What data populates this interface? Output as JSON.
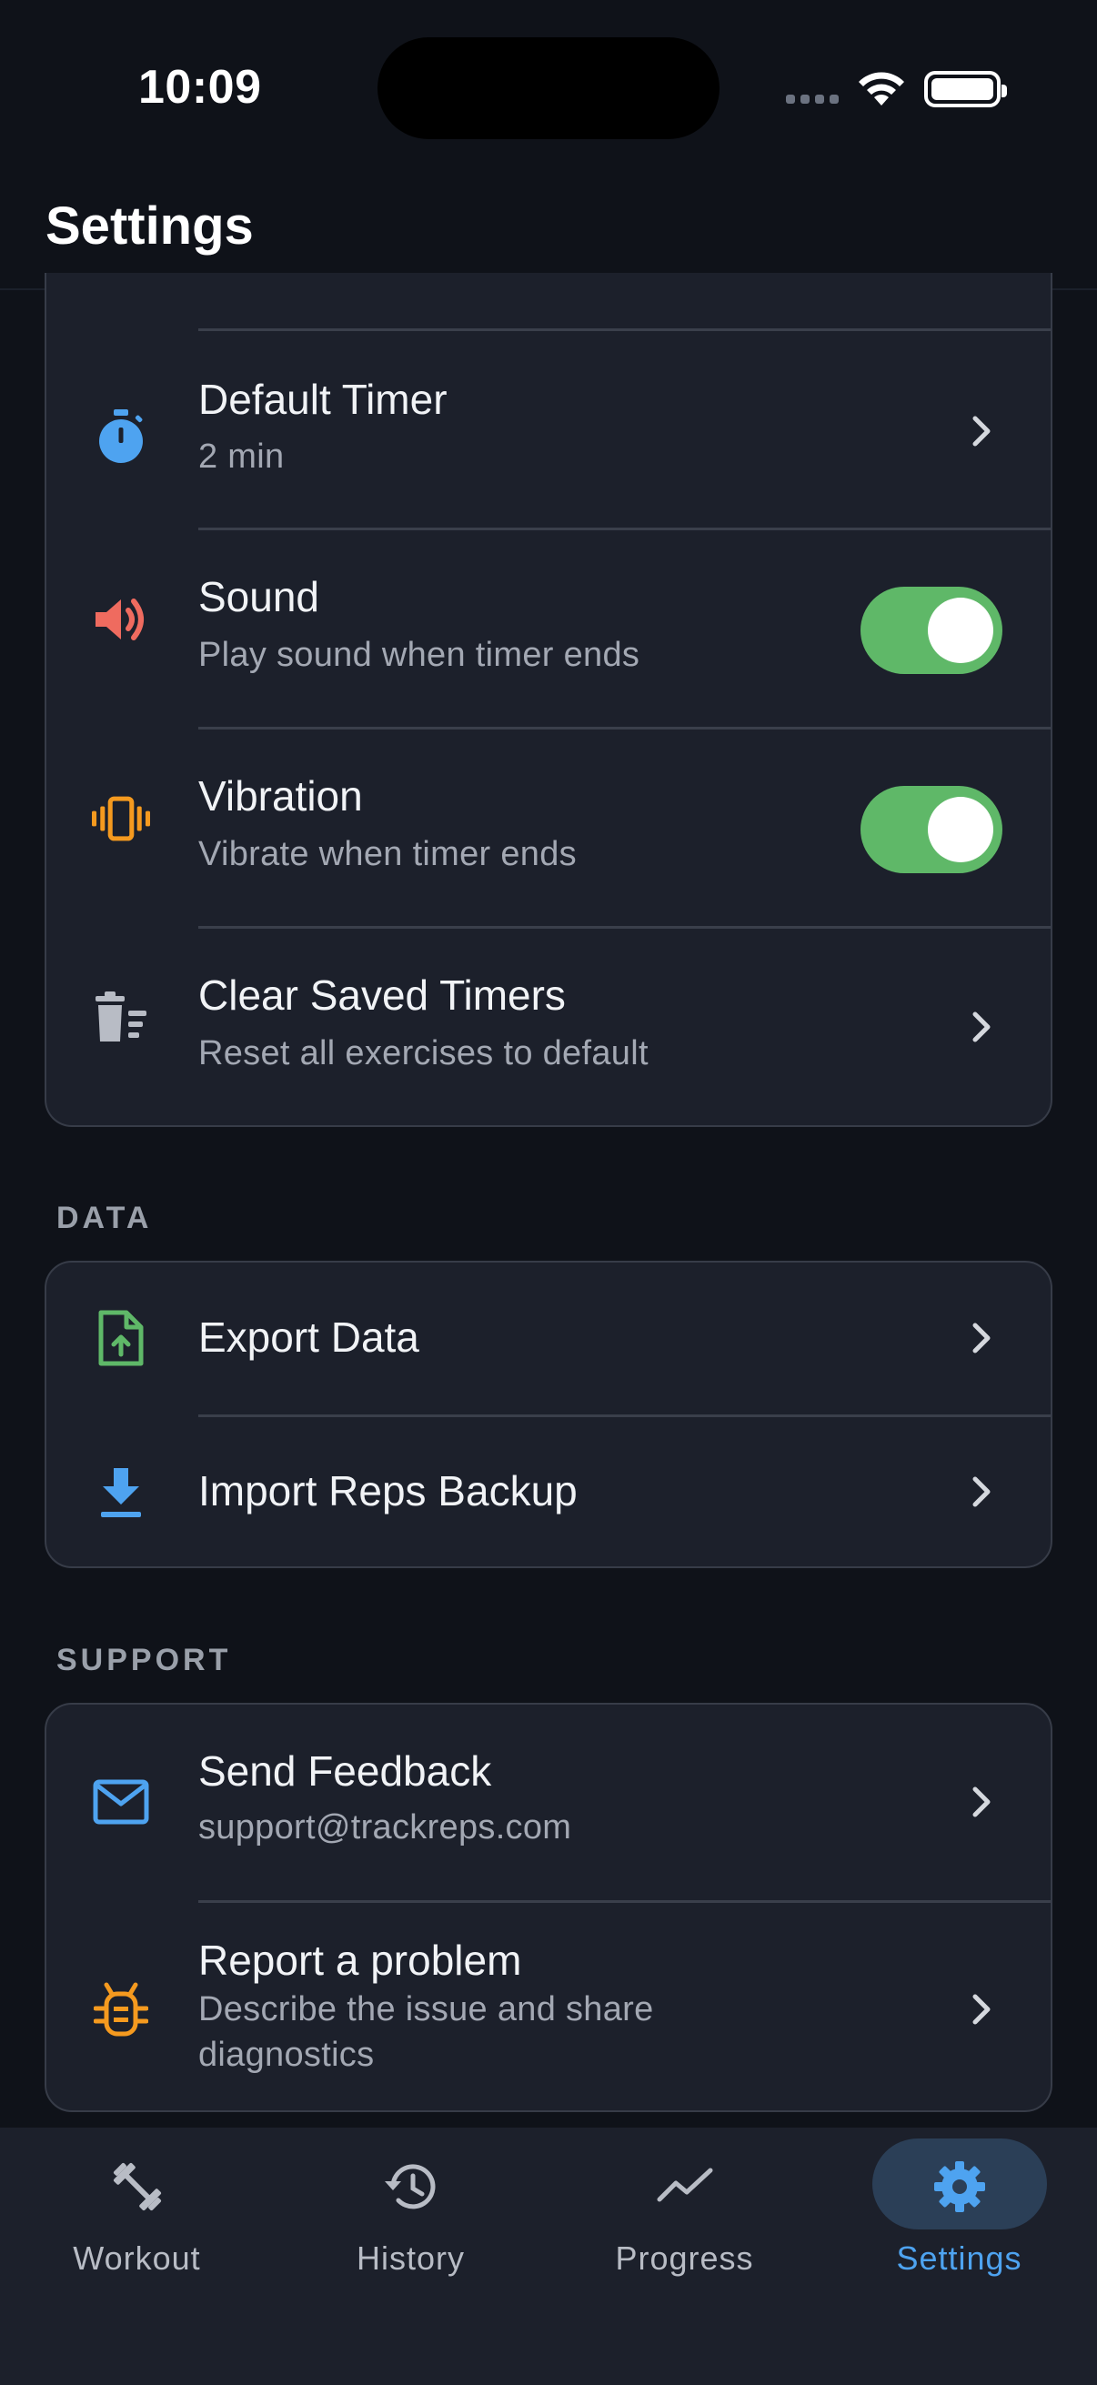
{
  "status_bar": {
    "time": "10:09"
  },
  "header": {
    "title": "Settings"
  },
  "timer_section": {
    "items": [
      {
        "title": "Default Timer",
        "subtitle": "2 min",
        "icon": "stopwatch-icon",
        "icon_color": "#4ea3f0"
      },
      {
        "title": "Sound",
        "subtitle": "Play sound when timer ends",
        "icon": "speaker-icon",
        "icon_color": "#ef6b5f",
        "toggle_on": true
      },
      {
        "title": "Vibration",
        "subtitle": "Vibrate when timer ends",
        "icon": "vibration-icon",
        "icon_color": "#f59a1f",
        "toggle_on": true
      },
      {
        "title": "Clear Saved Timers",
        "subtitle": "Reset all exercises to default",
        "icon": "trash-sweep-icon",
        "icon_color": "#b8bcc5"
      }
    ]
  },
  "data_section": {
    "label": "DATA",
    "items": [
      {
        "title": "Export Data",
        "icon": "file-upload-icon",
        "icon_color": "#5fb868"
      },
      {
        "title": "Import Reps Backup",
        "icon": "download-icon",
        "icon_color": "#4ea3f0"
      }
    ]
  },
  "support_section": {
    "label": "SUPPORT",
    "items": [
      {
        "title": "Send Feedback",
        "subtitle": "support@trackreps.com",
        "icon": "mail-icon",
        "icon_color": "#4ea3f0"
      },
      {
        "title": "Report a problem",
        "subtitle_line1": "Describe the issue and share",
        "subtitle_line2": "diagnostics",
        "icon": "bug-icon",
        "icon_color": "#f59a1f"
      }
    ]
  },
  "tab_bar": {
    "tabs": [
      {
        "label": "Workout",
        "icon": "dumbbell-icon"
      },
      {
        "label": "History",
        "icon": "history-icon"
      },
      {
        "label": "Progress",
        "icon": "trend-line-icon"
      },
      {
        "label": "Settings",
        "icon": "gear-icon",
        "active": true
      }
    ],
    "active_color": "#4ea3f0"
  }
}
